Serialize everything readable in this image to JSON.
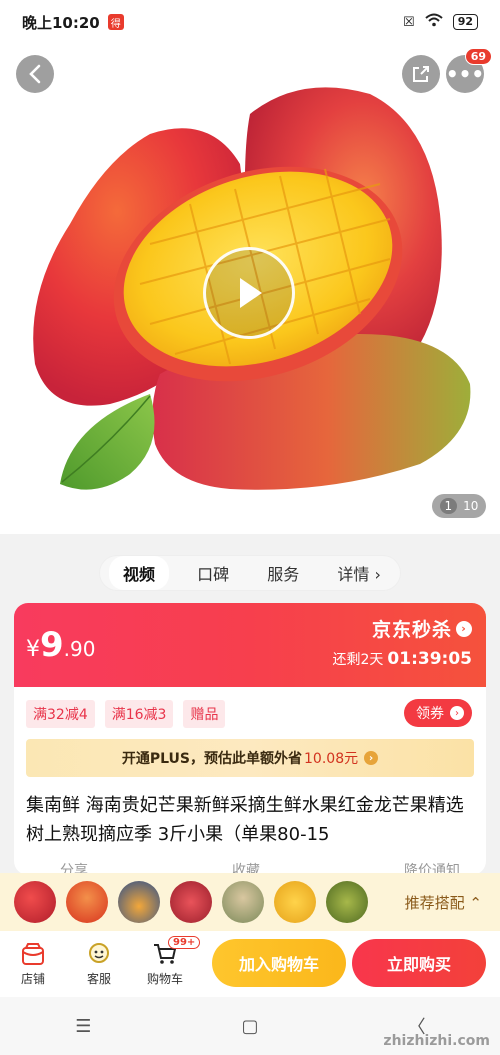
{
  "status_bar": {
    "time": "晚上10:20",
    "app_badge": "得",
    "battery": "92"
  },
  "hero": {
    "page_current": "1",
    "page_total": "10",
    "more_badge": "69"
  },
  "tabs": [
    "视频",
    "口碑",
    "服务",
    "详情"
  ],
  "price": {
    "currency": "¥",
    "integer": "9",
    "decimal": ".90",
    "seckill_label": "京东秒杀",
    "countdown_prefix": "还剩2天",
    "countdown_time": "01:39:05"
  },
  "coupons": [
    "满32减4",
    "满16减3",
    "赠品"
  ],
  "coupon_button": "领券",
  "plus_bar": {
    "text": "开通PLUS，预估此单额外省",
    "amount": "10.08元"
  },
  "product_title": "集南鲜 海南贵妃芒果新鲜采摘生鲜水果红金龙芒果精选树上熟现摘应季 3斤小果（单果80-15",
  "actions": [
    "分享",
    "收藏",
    "降价通知"
  ],
  "recommend_label": "推荐搭配",
  "bottom_bar": {
    "store": "店铺",
    "service": "客服",
    "cart": "购物车",
    "cart_badge": "99+",
    "add_to_cart": "加入购物车",
    "buy_now": "立即购买"
  },
  "colors": {
    "accent_red": "#f3413a",
    "cart_yellow": "#fbb71b",
    "plus_gold": "#fbe2a6"
  },
  "watermark": "zhizhizhi.com"
}
